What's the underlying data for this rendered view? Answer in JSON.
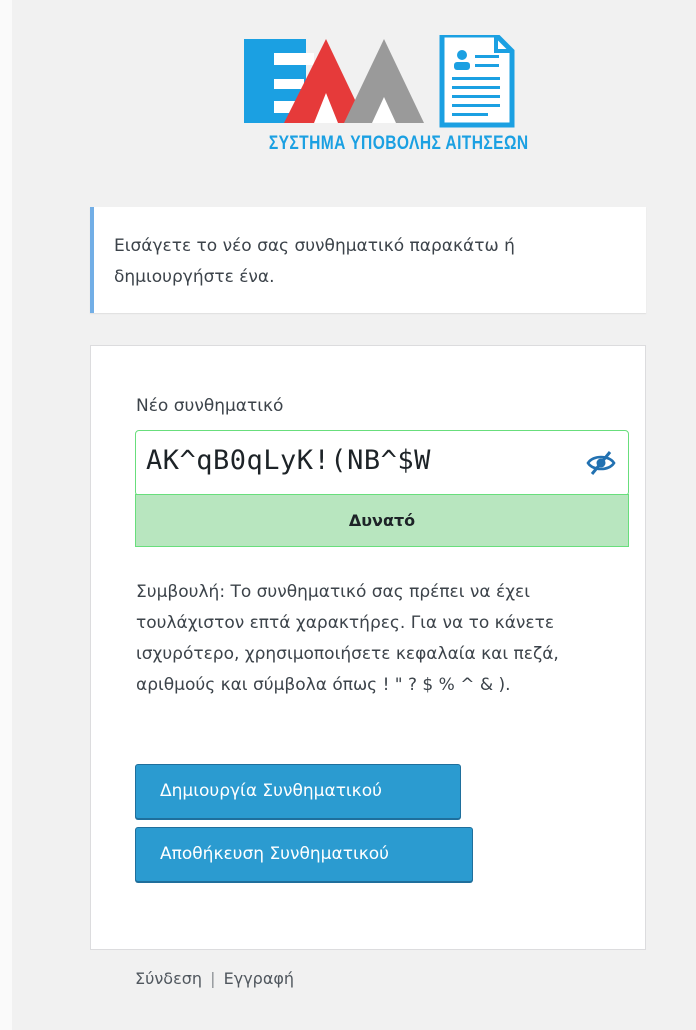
{
  "logo": {
    "brand_letters": "ΕΔΑ",
    "caption": "ΣΥΣΤΗΜΑ ΥΠΟΒΟΛΗΣ ΑΙΤΗΣΕΩΝ",
    "colors": {
      "blue": "#1ba0e2",
      "red": "#e63a3a",
      "gray": "#9a9a9a"
    }
  },
  "message": {
    "text": "Εισάγετε το νέο σας συνθηματικό παρακάτω ή δημιουργήστε ένα."
  },
  "form": {
    "password_label": "Νέο συνθηματικό",
    "password_value": "AK^qB0qLyK!(NB^$W",
    "visibility_icon": "eye-slash-icon",
    "strength_label": "Δυνατό",
    "hint_text": "Συμβουλή: Το συνθηματικό σας πρέπει να έχει τουλάχιστον επτά χαρακτήρες. Για να το κάνετε ισχυρότερο, χρησιμοποιήσετε κεφαλαία και πεζά, αριθμούς και σύμβολα όπως ! \" ? $ % ^ & ).",
    "generate_button": "Δημιουργία Συνθηματικού",
    "save_button": "Αποθήκευση Συνθηματικού"
  },
  "footer": {
    "login_link": "Σύνδεση",
    "separator": "|",
    "register_link": "Εγγραφή"
  },
  "colors": {
    "accent": "#2b9bd0",
    "strength_bg": "#b8e6bf",
    "message_border": "#72aee6"
  }
}
